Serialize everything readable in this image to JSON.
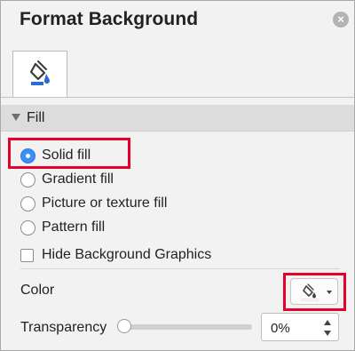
{
  "pane": {
    "title": "Format Background"
  },
  "tabs": [
    {
      "icon": "paint-bucket-icon",
      "selected": true
    }
  ],
  "fill_section": {
    "label": "Fill",
    "options": [
      {
        "label": "Solid fill",
        "selected": true
      },
      {
        "label": "Gradient fill",
        "selected": false
      },
      {
        "label": "Picture or texture fill",
        "selected": false
      },
      {
        "label": "Pattern fill",
        "selected": false
      }
    ],
    "hide_background_graphics": {
      "label": "Hide Background Graphics",
      "checked": false
    },
    "color": {
      "label": "Color",
      "icon": "paint-bucket-icon",
      "value": "#ffffff"
    },
    "transparency": {
      "label": "Transparency",
      "value": "0%",
      "level": 0
    }
  },
  "colors": {
    "accent_blue": "#3b8ff5",
    "highlight_red": "#e4002b",
    "bucket_blue": "#2a6bd6"
  }
}
